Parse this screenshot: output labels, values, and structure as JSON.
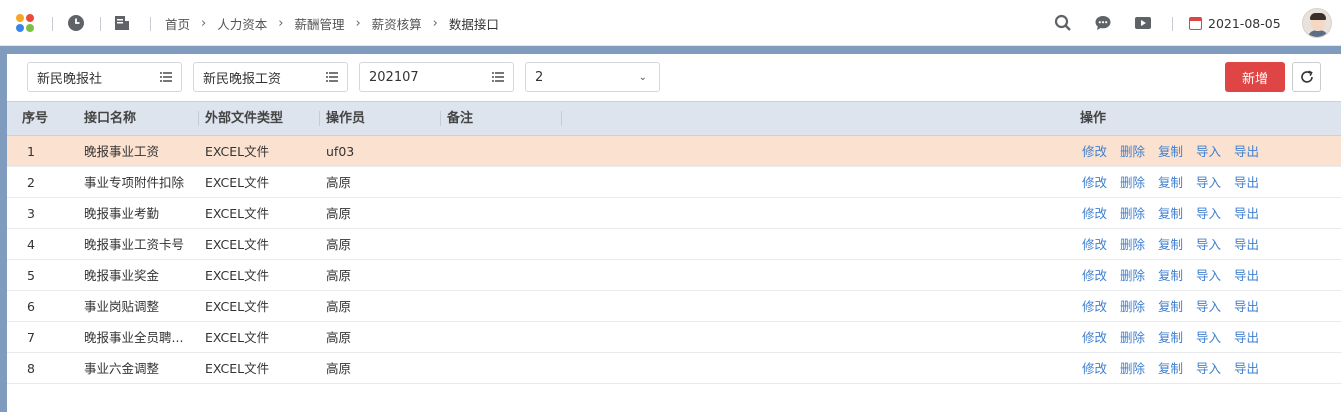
{
  "header": {
    "breadcrumb": [
      "首页",
      "人力资本",
      "薪酬管理",
      "薪资核算",
      "数据接口"
    ],
    "date": "2021-08-05"
  },
  "filters": {
    "org": "新民晚报社",
    "payroll": "新民晚报工资",
    "period": "202107",
    "batch": "2"
  },
  "toolbar": {
    "add_label": "新增"
  },
  "table": {
    "columns": {
      "index": "序号",
      "name": "接口名称",
      "file_type": "外部文件类型",
      "operator": "操作员",
      "remark": "备注",
      "actions": "操作"
    },
    "action_labels": [
      "修改",
      "删除",
      "复制",
      "导入",
      "导出"
    ],
    "rows": [
      {
        "index": "1",
        "name": "晚报事业工资",
        "file_type": "EXCEL文件",
        "operator": "uf03",
        "remark": ""
      },
      {
        "index": "2",
        "name": "事业专项附件扣除",
        "file_type": "EXCEL文件",
        "operator": "高原",
        "remark": ""
      },
      {
        "index": "3",
        "name": "晚报事业考勤",
        "file_type": "EXCEL文件",
        "operator": "高原",
        "remark": ""
      },
      {
        "index": "4",
        "name": "晚报事业工资卡号",
        "file_type": "EXCEL文件",
        "operator": "高原",
        "remark": ""
      },
      {
        "index": "5",
        "name": "晚报事业奖金",
        "file_type": "EXCEL文件",
        "operator": "高原",
        "remark": ""
      },
      {
        "index": "6",
        "name": "事业岗贴调整",
        "file_type": "EXCEL文件",
        "operator": "高原",
        "remark": ""
      },
      {
        "index": "7",
        "name": "晚报事业全员聘...",
        "file_type": "EXCEL文件",
        "operator": "高原",
        "remark": ""
      },
      {
        "index": "8",
        "name": "事业六金调整",
        "file_type": "EXCEL文件",
        "operator": "高原",
        "remark": ""
      }
    ],
    "selected_row_index": 0
  },
  "colors": {
    "accent": "#e04545",
    "link": "#3f7fd0",
    "header_bg": "#dde4ee",
    "selected_row": "#fbe1cf",
    "backdrop": "#7f9bbd"
  }
}
